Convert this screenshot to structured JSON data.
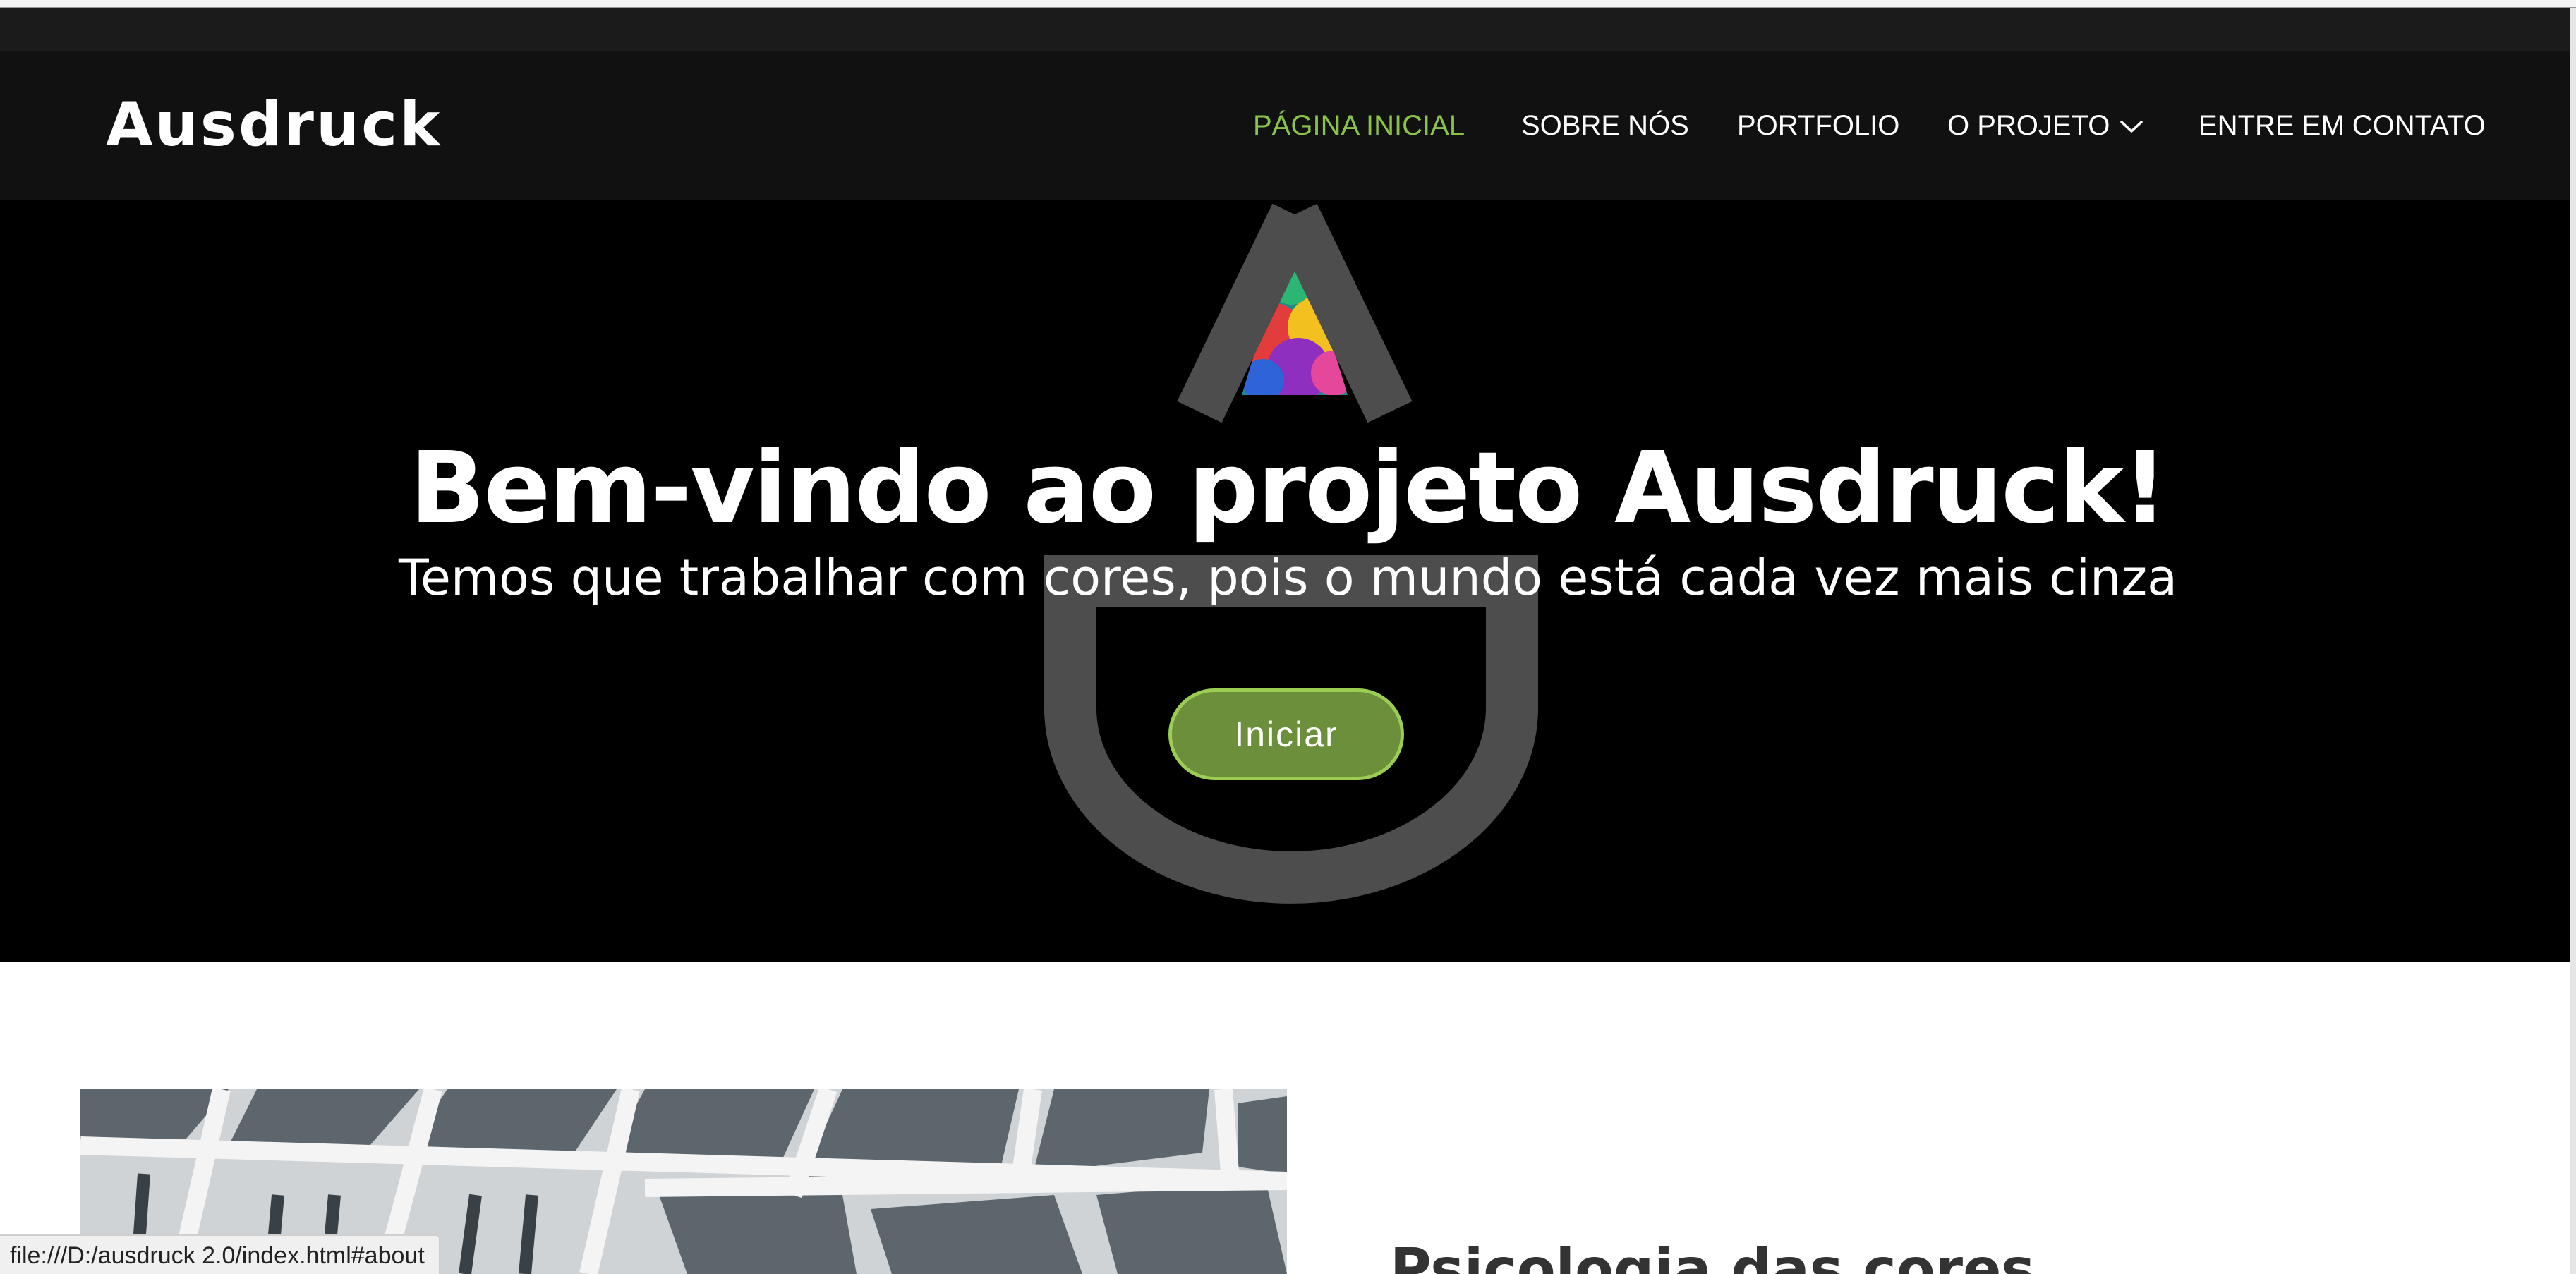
{
  "navbar": {
    "logo": "Ausdruck",
    "items": [
      {
        "label": "PÁGINA INICIAL",
        "active": true
      },
      {
        "label": "SOBRE NÓS",
        "active": false
      },
      {
        "label": "PORTFOLIO",
        "active": false
      },
      {
        "label": "O PROJETO",
        "active": false,
        "has_dropdown": true
      },
      {
        "label": "ENTRE EM CONTATO",
        "active": false
      }
    ]
  },
  "hero": {
    "title": "Bem-vindo ao projeto Ausdruck!",
    "subtitle": "Temos que trabalhar com cores, pois o mundo está cada vez mais cinza",
    "button_label": "Iniciar"
  },
  "about": {
    "heading": "Psicologia das cores"
  },
  "status_bar": {
    "url": "file:///D:/ausdruck 2.0/index.html#about"
  },
  "colors": {
    "accent_green": "#8bc34a",
    "button_green": "#6b8f3a",
    "navbar_bg": "#111111",
    "hero_bg": "#000000"
  }
}
